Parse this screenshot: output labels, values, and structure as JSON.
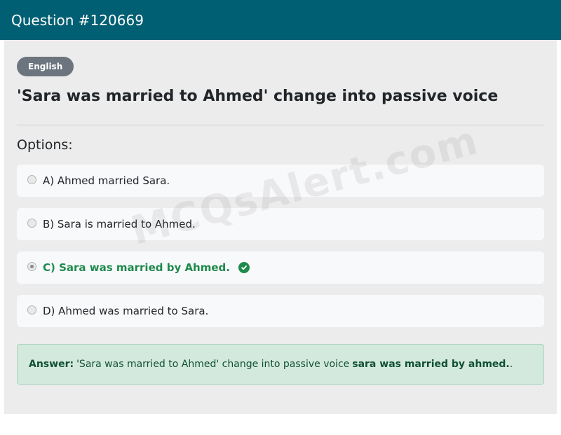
{
  "header": {
    "title": "Question #120669"
  },
  "badge": {
    "label": "English"
  },
  "question": {
    "text": "'Sara was married to Ahmed' change into passive voice"
  },
  "options_label": "Options:",
  "options": [
    {
      "text": "A) Ahmed married Sara.",
      "selected": false,
      "correct": false
    },
    {
      "text": "B) Sara is married to Ahmed.",
      "selected": false,
      "correct": false
    },
    {
      "text": "C) Sara was married by Ahmed.",
      "selected": true,
      "correct": true
    },
    {
      "text": "D) Ahmed was married to Sara.",
      "selected": false,
      "correct": false
    }
  ],
  "answer": {
    "label": "Answer:",
    "prefix": "'Sara was married to Ahmed' change into passive voice",
    "value": "sara was married by ahmed.",
    "suffix": "."
  },
  "watermark": "MCQsAlert.com",
  "colors": {
    "header_bg": "#005f73",
    "correct": "#1e8a4c",
    "answer_bg": "#d4e9de"
  }
}
